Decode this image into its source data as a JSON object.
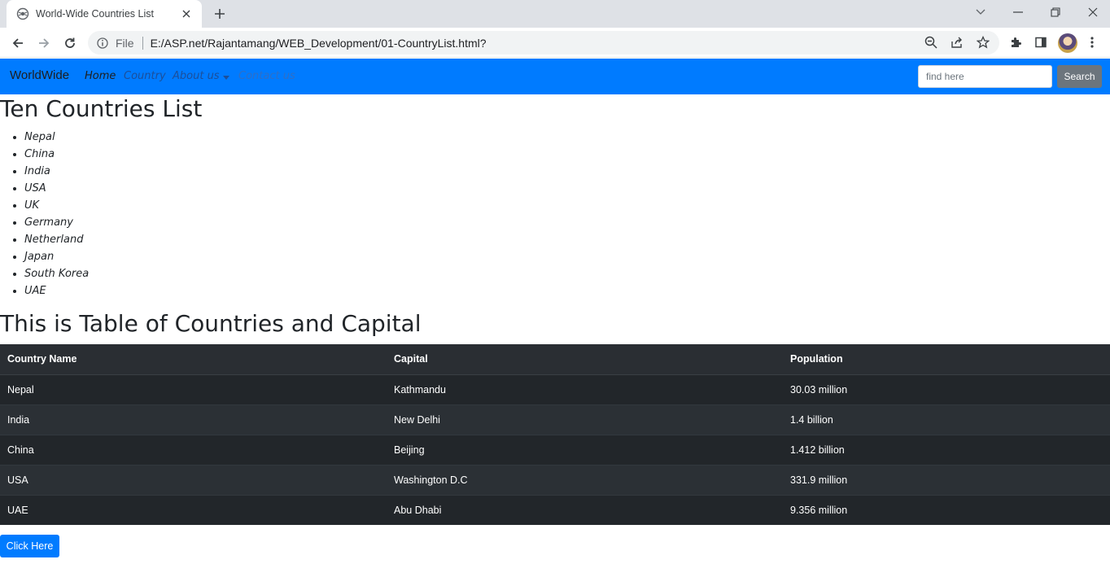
{
  "browser": {
    "tab_title": "World-Wide Countries List",
    "address_scheme": "File",
    "address_url": "E:/ASP.net/Rajantamang/WEB_Development/01-CountryList.html?"
  },
  "navbar": {
    "brand": "WorldWide",
    "links": {
      "home": "Home",
      "country": "Country",
      "about": "About us",
      "contact": "Contact us"
    },
    "search_placeholder": "find here",
    "search_button": "Search",
    "colors": {
      "background": "#007bff",
      "search_button": "#6c757d"
    }
  },
  "countries_section": {
    "heading": "Ten Countries List",
    "items": [
      "Nepal",
      "China",
      "India",
      "USA",
      "UK",
      "Germany",
      "Netherland",
      "Japan",
      "South Korea",
      "UAE"
    ]
  },
  "table_section": {
    "heading": "This is Table of Countries and Capital",
    "columns": [
      "Country Name",
      "Capital",
      "Population"
    ],
    "rows": [
      [
        "Nepal",
        "Kathmandu",
        "30.03 million"
      ],
      [
        "India",
        "New Delhi",
        "1.4 billion"
      ],
      [
        "China",
        "Beijing",
        "1.412 billion"
      ],
      [
        "USA",
        "Washington D.C",
        "331.9 million"
      ],
      [
        "UAE",
        "Abu Dhabi",
        "9.356 million"
      ]
    ]
  },
  "action_button": "Click Here"
}
